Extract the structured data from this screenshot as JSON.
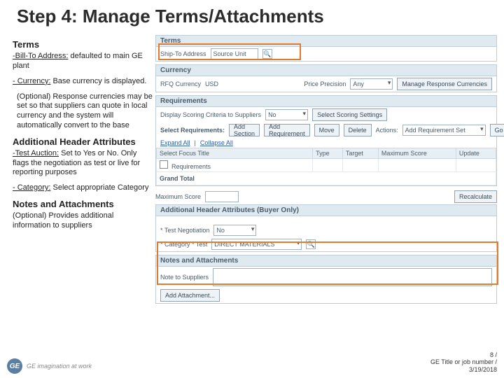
{
  "title": "Step 4: Manage Terms/Attachments",
  "left": {
    "h1": "Terms",
    "p1a": "-Bill-To Address:",
    "p1b": "defaulted to main GE plant",
    "p2a": "- Currency:",
    "p2b": "Base currency is displayed.",
    "p3": "(Optional) Response currencies may be set so that suppliers can quote in local currency and the system will automatically convert to the base",
    "h2": "Additional Header Attributes",
    "p4a": "-Test Auction:",
    "p4b": "Set to Yes or No. Only flags the negotiation as test or live for reporting purposes",
    "p5a": "- Category:",
    "p5b": "Select appropriate Category",
    "h3": "Notes and Attachments",
    "p6": "(Optional) Provides additional information to suppliers"
  },
  "terms": {
    "title": "Terms",
    "shipToLabel": "Ship-To Address",
    "shipToValue": "Source Unit"
  },
  "currency": {
    "title": "Currency",
    "rfqLabel": "RFQ Currency",
    "rfqValue": "USD",
    "pricePrecisionLabel": "Price Precision",
    "pricePrecisionValue": "Any",
    "manageBtn": "Manage Response Currencies"
  },
  "req": {
    "title": "Requirements",
    "displayLabel": "Display Scoring Criteria to Suppliers",
    "displayValue": "No",
    "scoringBtn": "Select Scoring Settings",
    "selectReq": "Select Requirements:",
    "btns": {
      "addSection": "Add Section",
      "addReq": "Add Requirement",
      "move": "Move",
      "delete": "Delete"
    },
    "actionsLabel": "Actions:",
    "actionsValue": "Add Requirement Set",
    "go": "Go",
    "links": {
      "expand": "Expand All",
      "collapse": "Collapse All"
    },
    "cols": {
      "selectFocus": "Select Focus Title",
      "type": "Type",
      "target": "Target",
      "maxScore": "Maximum Score",
      "update": "Update"
    },
    "rowName": "Requirements",
    "grandTotal": "Grand Total"
  },
  "maxScore": {
    "label": "Maximum Score",
    "empty": "",
    "recalc": "Recalculate"
  },
  "addl": {
    "title": "Additional Header Attributes (Buyer Only)",
    "testLabel": "* Test Negotiation",
    "testValue": "No",
    "catLabel": "* Category * Test",
    "catValue": "DIRECT MATERIALS"
  },
  "notes": {
    "title": "Notes and Attachments",
    "noteLabel": "Note to Suppliers",
    "addBtn": "Add Attachment..."
  },
  "footer": {
    "logoText": "GE imagination at work",
    "page": "8 /",
    "meta": "GE Title or job number /",
    "date": "3/19/2018"
  }
}
